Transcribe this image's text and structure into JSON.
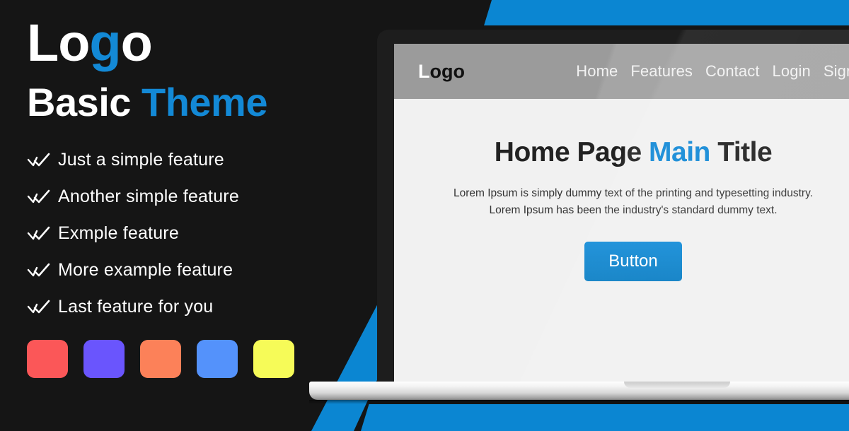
{
  "hero": {
    "logo_prefix": "Lo",
    "logo_accent": "g",
    "logo_suffix": "o",
    "tagline_main": "Basic ",
    "tagline_accent": "Theme",
    "features": [
      {
        "icon": "double-check-icon",
        "label": "Just a simple feature"
      },
      {
        "icon": "double-check-icon",
        "label": "Another simple feature"
      },
      {
        "icon": "double-check-icon",
        "label": "Exmple feature"
      },
      {
        "icon": "double-check-icon",
        "label": "More example feature"
      },
      {
        "icon": "double-check-icon",
        "label": "Last feature for you"
      }
    ],
    "swatches": [
      {
        "name": "swatch-red",
        "color": "#FB5758"
      },
      {
        "name": "swatch-purple",
        "color": "#6A55FD"
      },
      {
        "name": "swatch-orange",
        "color": "#FC8159"
      },
      {
        "name": "swatch-blue",
        "color": "#5492FB"
      },
      {
        "name": "swatch-yellow",
        "color": "#F6FB58"
      }
    ]
  },
  "theme": {
    "accent_blue": "#1389D6",
    "background_dark": "#151515",
    "background_blue": "#0B86D2",
    "navbar_gray": "#9B9B9B",
    "screen_bg": "#F1F1F1"
  },
  "preview": {
    "nav": {
      "logo_lead": "L",
      "logo_rest": "ogo",
      "links": [
        {
          "label": "Home"
        },
        {
          "label": "Features"
        },
        {
          "label": "Contact"
        },
        {
          "label": "Login"
        },
        {
          "label": "Signup"
        }
      ]
    },
    "content": {
      "title_before": "Home Page ",
      "title_accent": "Main",
      "title_after": " Title",
      "paragraph_line1": "Lorem Ipsum is simply dummy text of the printing and typesetting industry.",
      "paragraph_line2": "Lorem Ipsum has been the industry's standard dummy text.",
      "button_label": "Button"
    }
  }
}
